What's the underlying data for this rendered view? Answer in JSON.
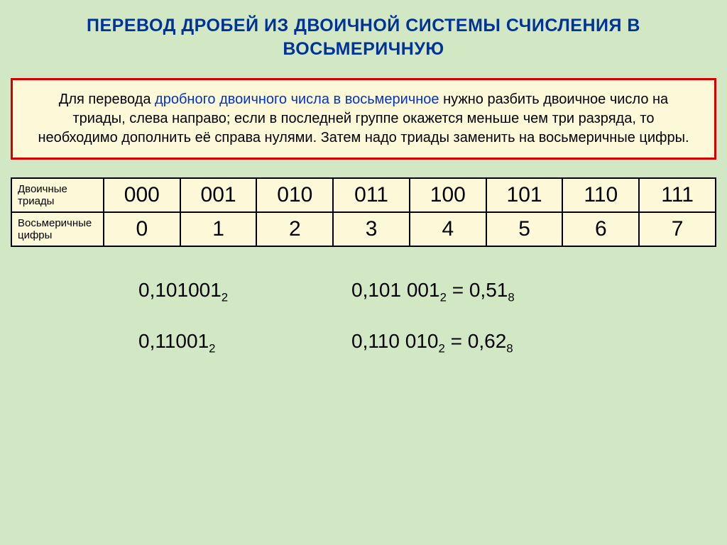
{
  "title": "ПЕРЕВОД ДРОБЕЙ ИЗ ДВОИЧНОЙ СИСТЕМЫ СЧИСЛЕНИЯ В ВОСЬМЕРИЧНУЮ",
  "rule": {
    "part1": "Для перевода ",
    "highlight": "дробного двоичного числа в восьмеричное",
    "part2": " нужно разбить двоичное число на триады, слева направо; если в последней группе окажется меньше чем три разряда, то необходимо дополнить её справа нулями. Затем надо триады заменить на восьмеричные цифры."
  },
  "table": {
    "row1_label": "Двоичные триады",
    "row2_label": "Восьмеричные цифры",
    "triads": [
      "000",
      "001",
      "010",
      "011",
      "100",
      "101",
      "110",
      "111"
    ],
    "octals": [
      "0",
      "1",
      "2",
      "3",
      "4",
      "5",
      "6",
      "7"
    ]
  },
  "ex": {
    "r1_left_val": "0,101001",
    "r1_left_sub": "2",
    "r1_right_a_val": "0,101 001",
    "r1_right_a_sub": "2",
    "r1_right_eq": " = ",
    "r1_right_b_val": "0,51",
    "r1_right_b_sub": "8",
    "r2_left_val": "0,11001",
    "r2_left_sub": "2",
    "r2_right_a_val": "0,110 010",
    "r2_right_a_sub": "2",
    "r2_right_eq": " = ",
    "r2_right_b_val": "0,62",
    "r2_right_b_sub": "8"
  }
}
